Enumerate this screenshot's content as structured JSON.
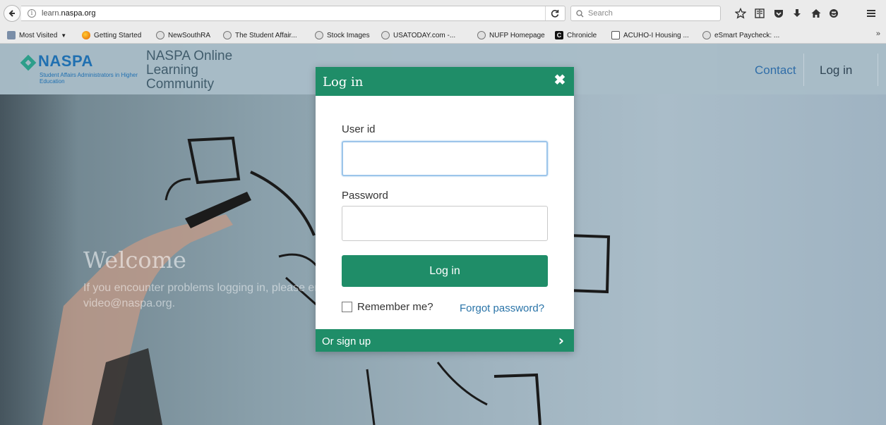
{
  "browser": {
    "url_prefix": "learn.",
    "url_domain": "naspa.org",
    "search_placeholder": "Search"
  },
  "bookmarks": [
    {
      "label": "Most Visited",
      "icon": "folder-icon"
    },
    {
      "label": "Getting Started",
      "icon": "firefox-icon"
    },
    {
      "label": "NewSouthRA",
      "icon": "globe-icon"
    },
    {
      "label": "The Student Affair...",
      "icon": "globe-icon"
    },
    {
      "label": "Stock Images",
      "icon": "globe-icon"
    },
    {
      "label": "USATODAY.com -...",
      "icon": "globe-icon"
    },
    {
      "label": "NUFP Homepage",
      "icon": "globe-icon"
    },
    {
      "label": "Chronicle",
      "icon": "chronicle-icon"
    },
    {
      "label": "ACUHO-I Housing ...",
      "icon": "acuho-icon"
    },
    {
      "label": "eSmart Paycheck: ...",
      "icon": "globe-icon"
    }
  ],
  "header": {
    "logo_word": "NASPA",
    "logo_tagline": "Student Affairs Administrators in Higher Education",
    "site_name": "NASPA Online Learning Community",
    "nav_contact": "Contact",
    "nav_login": "Log in"
  },
  "hero": {
    "welcome": "Welcome",
    "message": "If you encounter problems logging in, please email video@naspa.org."
  },
  "modal": {
    "title": "Log in",
    "close_symbol": "✖",
    "userid_label": "User id",
    "userid_value": "",
    "password_label": "Password",
    "password_value": "",
    "login_button": "Log in",
    "remember_label": "Remember me?",
    "remember_checked": false,
    "forgot_link": "Forgot password?",
    "signup_label": "Or sign up",
    "signup_chevron": "›"
  },
  "colors": {
    "brand_green": "#1f8d68",
    "link_blue": "#2a74a8",
    "naspa_blue": "#1c6fb3"
  }
}
